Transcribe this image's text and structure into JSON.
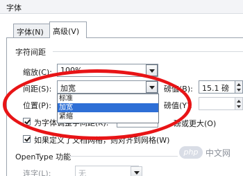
{
  "window": {
    "title": "字体"
  },
  "tabs": [
    {
      "label": "字体(N)"
    },
    {
      "label": "高级(V)"
    }
  ],
  "character_spacing": {
    "section_title": "字符间距",
    "scale": {
      "label": "缩放(C):",
      "value": "100%"
    },
    "spacing": {
      "label": "间距(S):",
      "value": "加宽",
      "by_label": "磅值(B):",
      "by_value": "15.1 磅"
    },
    "position": {
      "label": "位置(P):",
      "by_label": "磅值(Y):"
    },
    "dropdown_options": [
      "标准",
      "加宽",
      "紧缩"
    ],
    "dropdown_selected_index": 1,
    "kerning": {
      "label": "为字体调整字间距(K):",
      "suffix": "磅或更大(O)",
      "checked": true
    },
    "snap_grid": {
      "label": "如果定义了文档网格，则对齐到网格(W)",
      "checked": true
    }
  },
  "opentype": {
    "section_title": "OpenType 功能",
    "ligatures": {
      "label": "连字(L):",
      "value": "无"
    }
  },
  "watermark": {
    "logo": "php",
    "text": "中文网"
  },
  "colors": {
    "annotation": "#e81416",
    "selection": "#2e6fd6"
  }
}
